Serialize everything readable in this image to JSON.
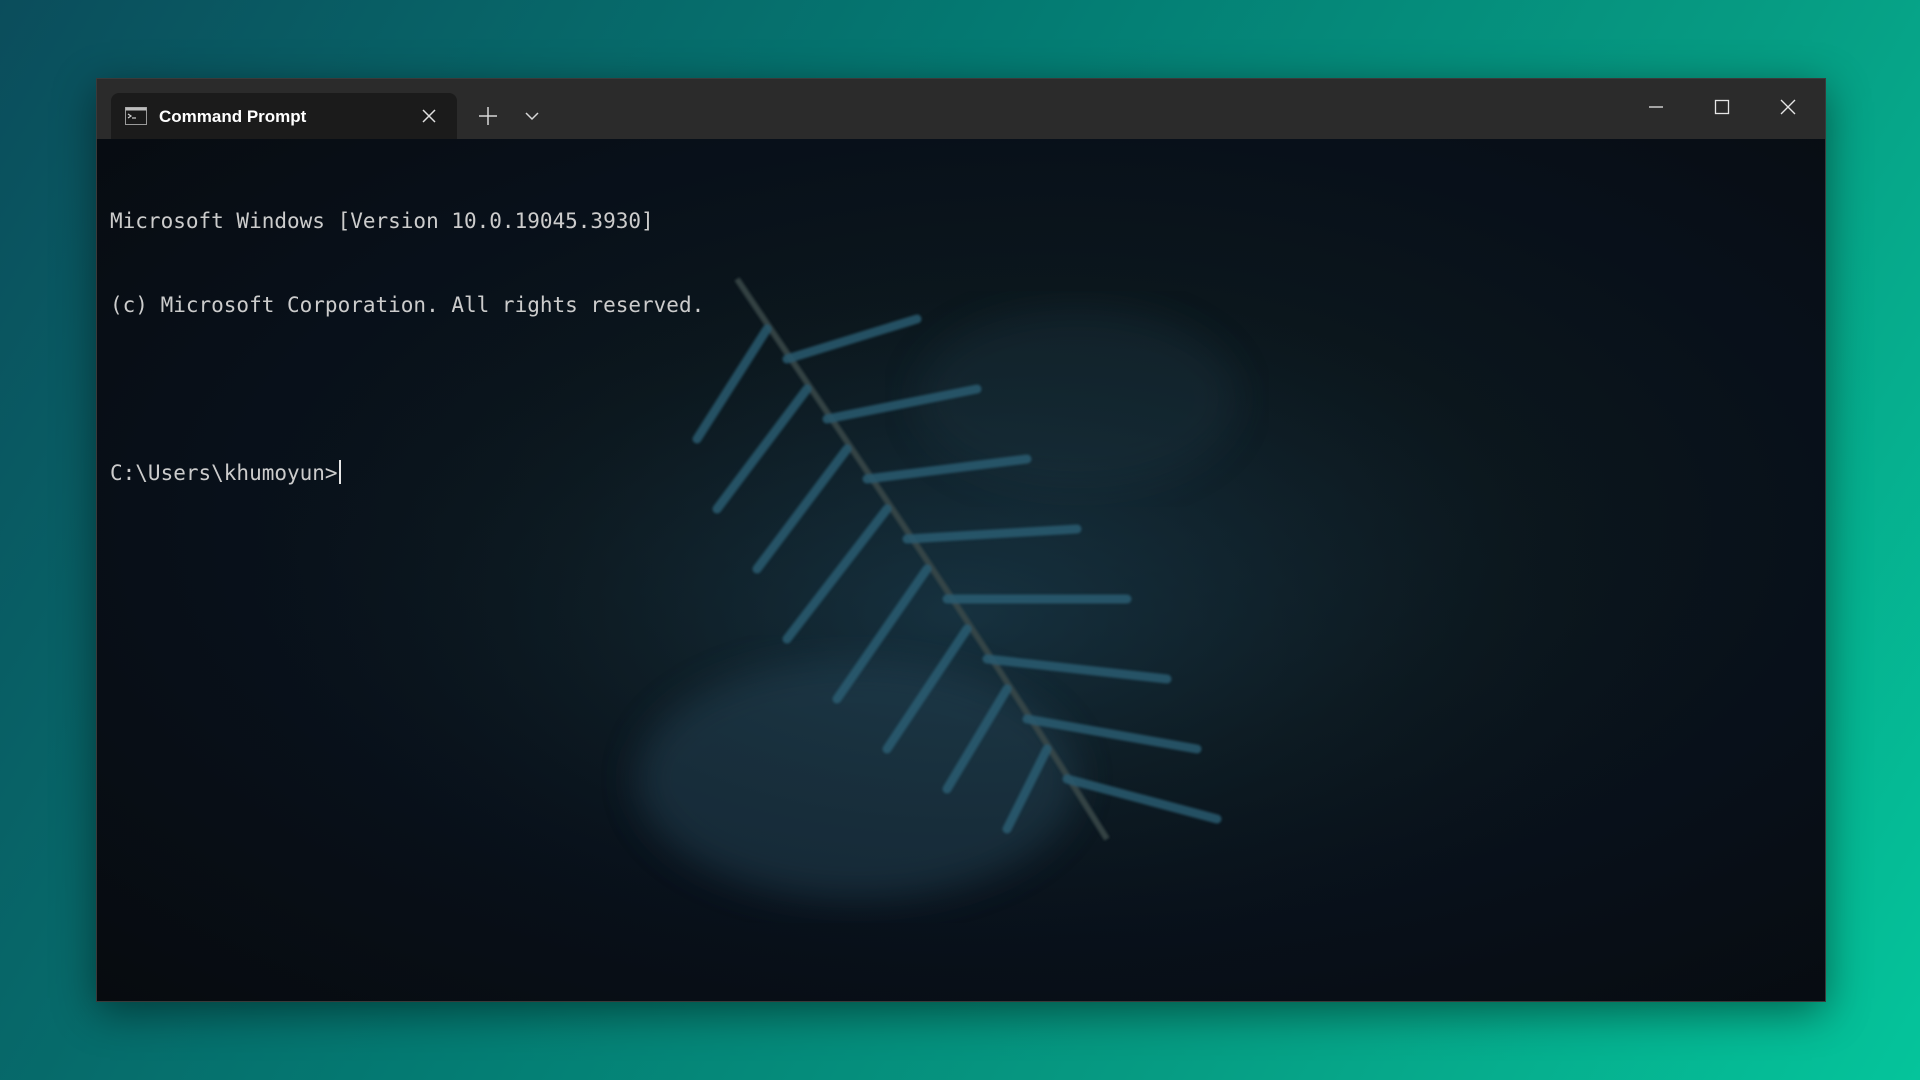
{
  "window": {
    "tab_title": "Command Prompt",
    "tab_icon": "cmd-icon",
    "new_tab_icon": "plus-icon",
    "dropdown_icon": "chevron-down-icon",
    "controls": {
      "minimize_icon": "minimize-icon",
      "maximize_icon": "maximize-icon",
      "close_icon": "close-icon"
    }
  },
  "terminal": {
    "lines": [
      "Microsoft Windows [Version 10.0.19045.3930]",
      "(c) Microsoft Corporation. All rights reserved.",
      "",
      "C:\\Users\\khumoyun>"
    ],
    "text_color": "#cccccc",
    "background_color": "#0c0c0c"
  },
  "colors": {
    "titlebar": "#2b2b2b",
    "active_tab": "#1b1b1b",
    "desktop_gradient_start": "#0b4d5c",
    "desktop_gradient_end": "#05c49b"
  }
}
